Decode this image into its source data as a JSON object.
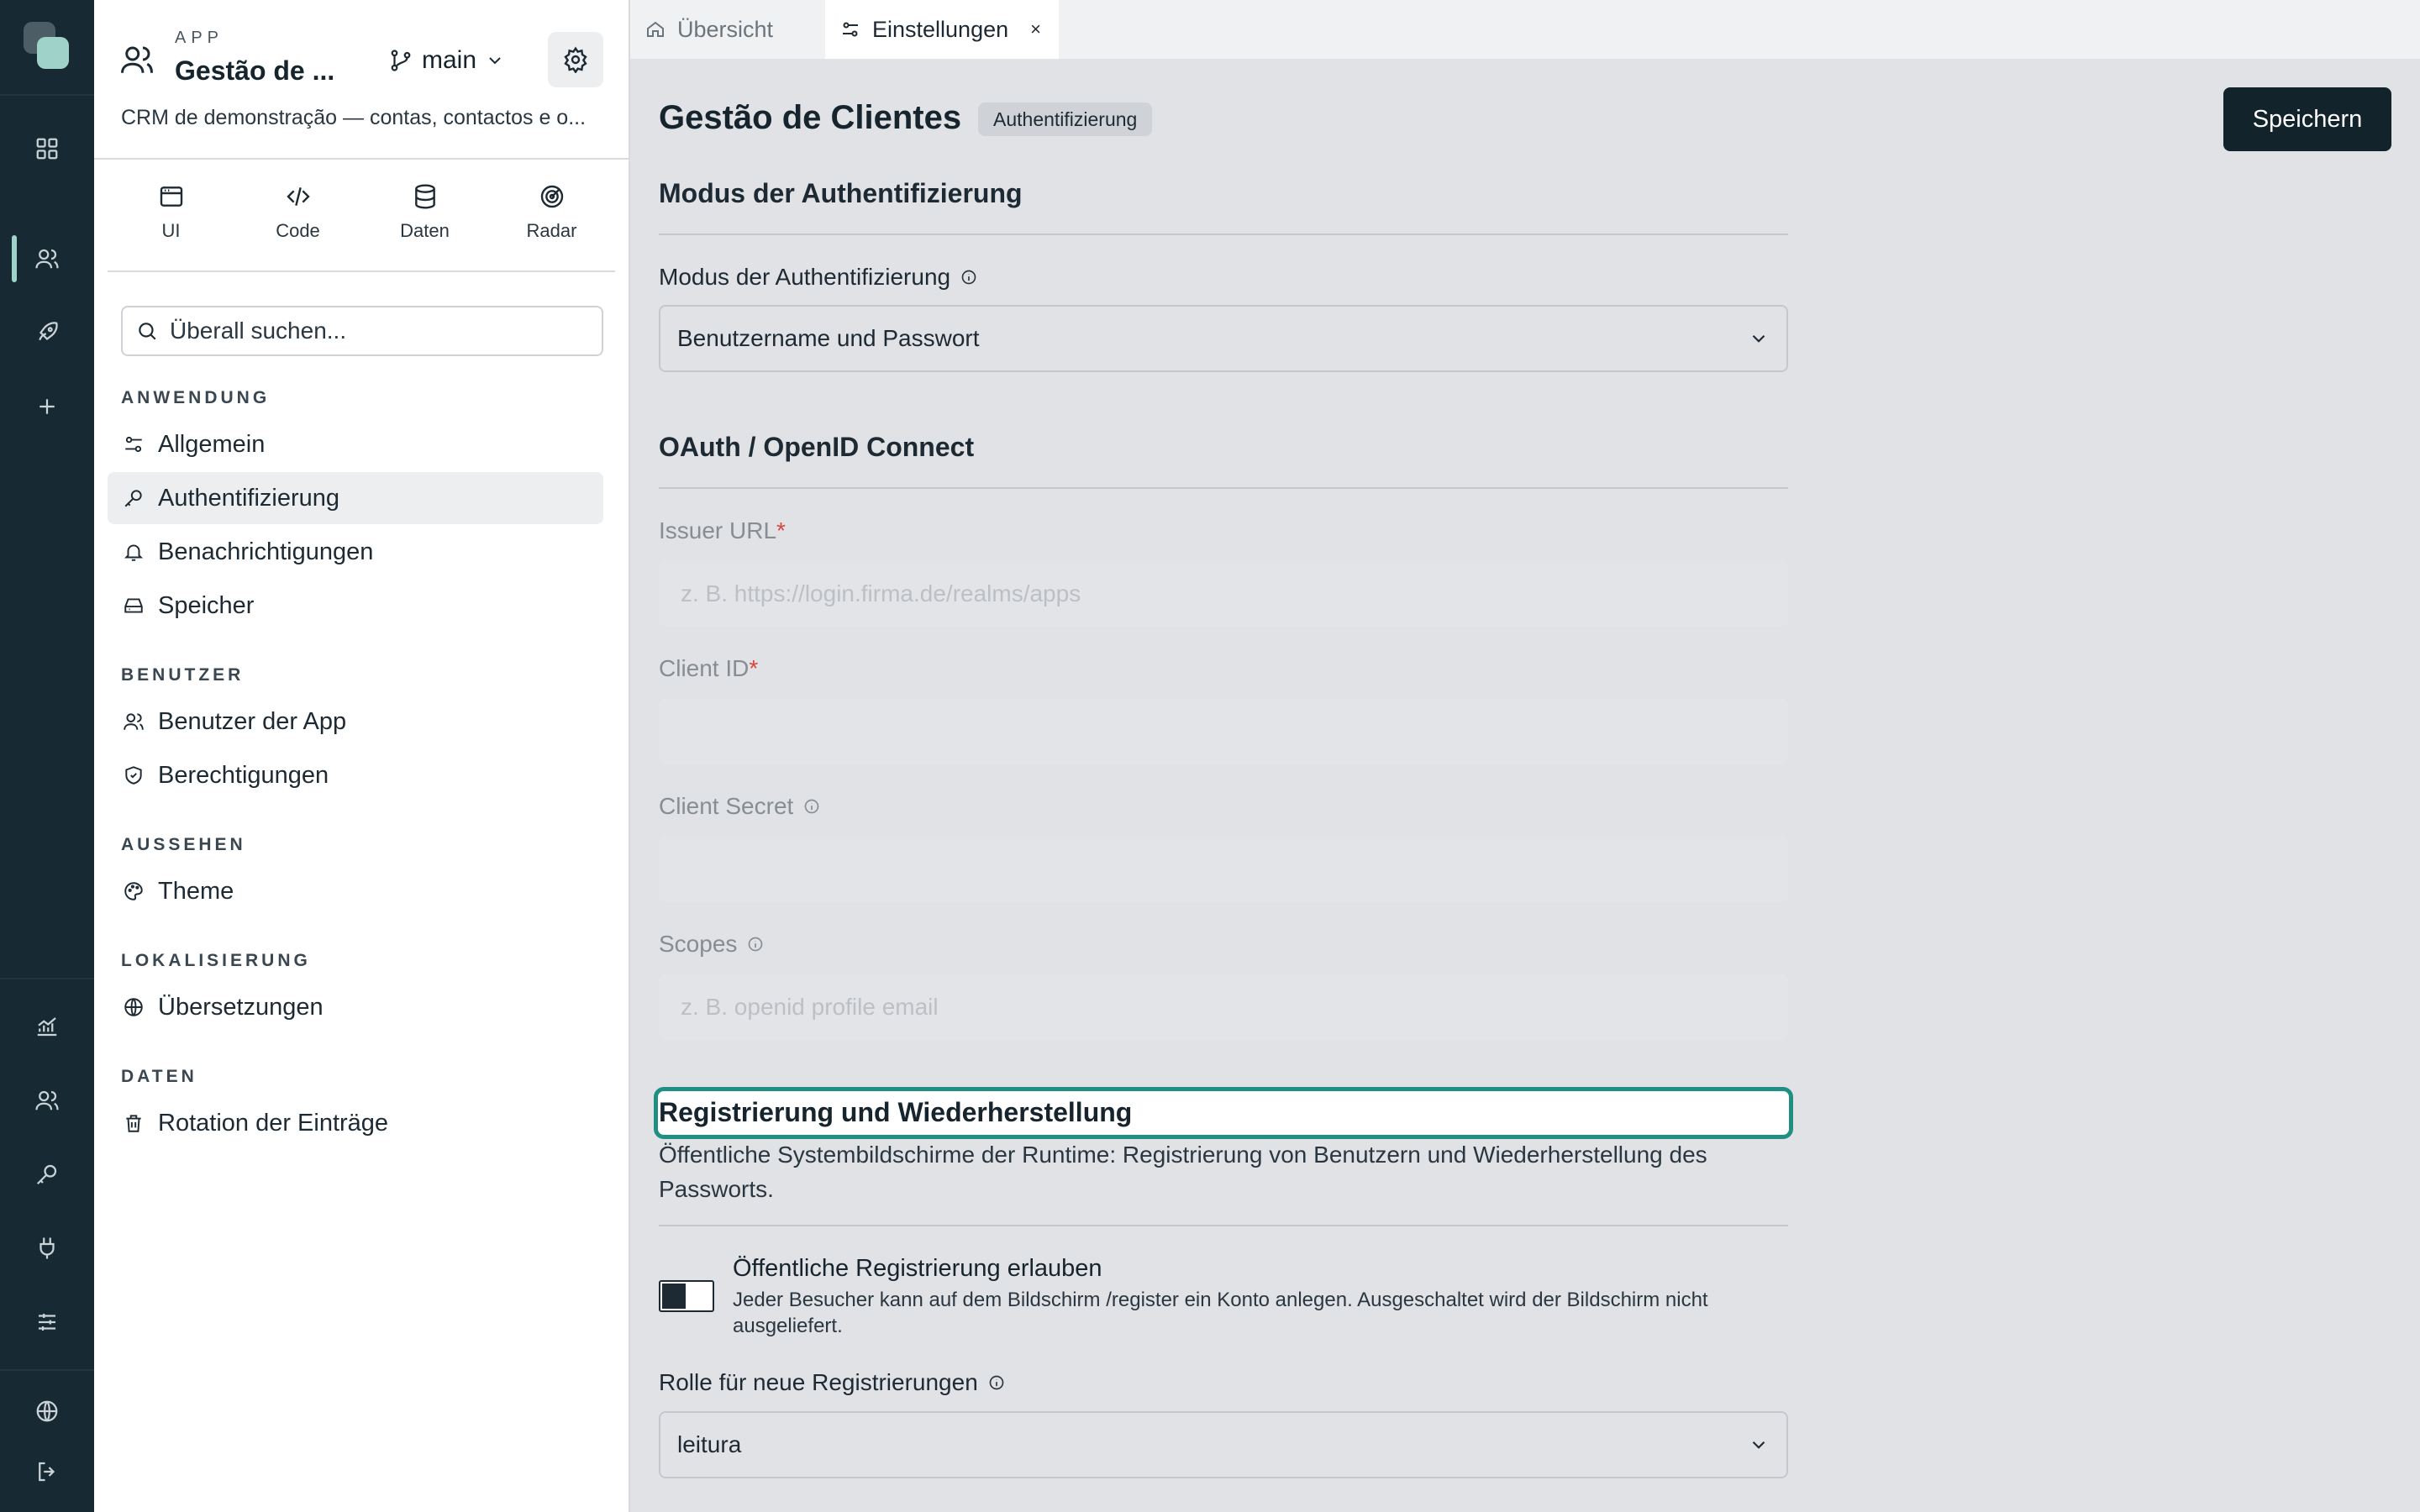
{
  "app": {
    "kicker": "APP",
    "title": "Gestão de ...",
    "branch": "main",
    "description": "CRM de demonstração — contas, contactos e o..."
  },
  "modes": [
    {
      "label": "UI",
      "icon": "window-icon"
    },
    {
      "label": "Code",
      "icon": "code-icon"
    },
    {
      "label": "Daten",
      "icon": "database-icon"
    },
    {
      "label": "Radar",
      "icon": "radar-icon"
    }
  ],
  "search": {
    "placeholder": "Überall suchen..."
  },
  "nav": {
    "sections": [
      {
        "title": "ANWENDUNG",
        "items": [
          {
            "label": "Allgemein",
            "icon": "sliders-icon"
          },
          {
            "label": "Authentifizierung",
            "icon": "key-icon",
            "active": true
          },
          {
            "label": "Benachrichtigungen",
            "icon": "bell-icon"
          },
          {
            "label": "Speicher",
            "icon": "drive-icon"
          }
        ]
      },
      {
        "title": "BENUTZER",
        "items": [
          {
            "label": "Benutzer der App",
            "icon": "users-icon"
          },
          {
            "label": "Berechtigungen",
            "icon": "shield-icon"
          }
        ]
      },
      {
        "title": "AUSSEHEN",
        "items": [
          {
            "label": "Theme",
            "icon": "palette-icon"
          }
        ]
      },
      {
        "title": "LOKALISIERUNG",
        "items": [
          {
            "label": "Übersetzungen",
            "icon": "globe-icon"
          }
        ]
      },
      {
        "title": "DATEN",
        "items": [
          {
            "label": "Rotation der Einträge",
            "icon": "trash-icon"
          }
        ]
      }
    ]
  },
  "tabs": [
    {
      "label": "Übersicht",
      "icon": "home-icon"
    },
    {
      "label": "Einstellungen",
      "icon": "sliders-icon",
      "close": "×"
    }
  ],
  "page": {
    "title": "Gestão de Clientes",
    "badge": "Authentifizierung",
    "save": "Speichern"
  },
  "auth_mode": {
    "heading": "Modus der Authentifizierung",
    "label": "Modus der Authentifizierung",
    "value": "Benutzername und Passwort"
  },
  "oauth": {
    "heading": "OAuth / OpenID Connect",
    "issuer_label": "Issuer URL",
    "issuer_placeholder": "z. B. https://login.firma.de/realms/apps",
    "client_id_label": "Client ID",
    "client_secret_label": "Client Secret",
    "scopes_label": "Scopes",
    "scopes_placeholder": "z. B. openid profile email",
    "required_mark": "*"
  },
  "registration": {
    "heading": "Registrierung und Wiederherstellung",
    "description": "Öffentliche Systembildschirme der Runtime: Registrierung von Benutzern und Wiederherstellung des Passworts.",
    "toggle_label": "Öffentliche Registrierung erlauben",
    "toggle_help": "Jeder Besucher kann auf dem Bildschirm /register ein Konto anlegen. Ausgeschaltet wird der Bildschirm nicht ausgeliefert.",
    "toggle_on": true,
    "role_label": "Rolle für neue Registrierungen",
    "role_value": "leitura"
  },
  "colors": {
    "rail": "#172932",
    "accent": "#9fd3c9",
    "focus": "#1f8f83",
    "primary_button": "#12232c",
    "required": "#d9453a"
  }
}
